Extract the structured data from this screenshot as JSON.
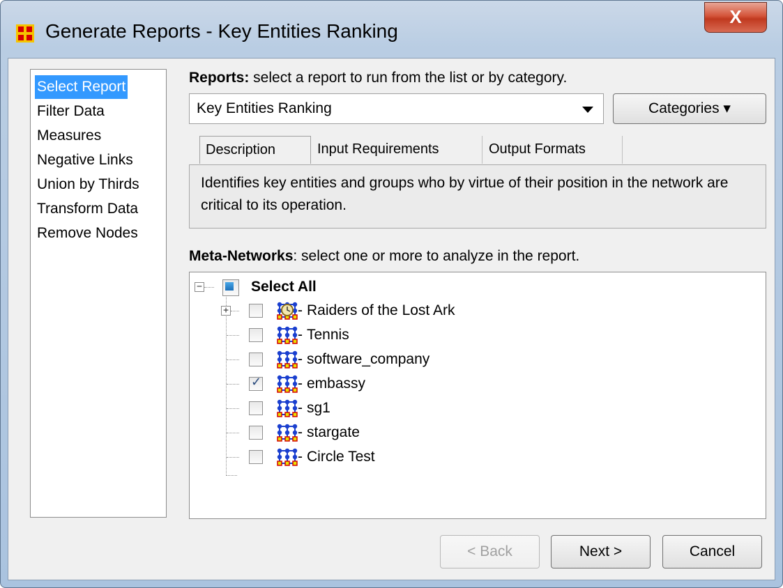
{
  "window": {
    "title": "Generate Reports - Key Entities Ranking",
    "close_label": "X"
  },
  "nav": {
    "items": [
      {
        "label": "Select Report",
        "selected": true
      },
      {
        "label": "Filter Data"
      },
      {
        "label": "Measures"
      },
      {
        "label": "Negative Links"
      },
      {
        "label": "Union by Thirds"
      },
      {
        "label": "Transform Data"
      },
      {
        "label": "Remove Nodes"
      }
    ]
  },
  "reports": {
    "heading_bold": "Reports:",
    "heading_rest": " select a report to run from the list or by category.",
    "selected": "Key Entities Ranking",
    "categories_label": "Categories ▾"
  },
  "tabs": [
    {
      "label": "Description",
      "active": true
    },
    {
      "label": "Input Requirements"
    },
    {
      "label": "Output Formats"
    }
  ],
  "description": "Identifies key entities and groups who by virtue of their position in the network are critical to its operation.",
  "meta": {
    "heading_bold": "Meta-Networks",
    "heading_rest": ": select one or more to analyze in the report.",
    "select_all": "Select All",
    "items": [
      {
        "label": "Raiders of the Lost Ark",
        "checked": false,
        "icon": "timed-network-icon",
        "expandable": true
      },
      {
        "label": "Tennis",
        "checked": false,
        "icon": "network-icon"
      },
      {
        "label": "software_company",
        "checked": false,
        "icon": "network-icon"
      },
      {
        "label": "embassy",
        "checked": true,
        "icon": "network-icon"
      },
      {
        "label": "sg1",
        "checked": false,
        "icon": "network-icon"
      },
      {
        "label": "stargate",
        "checked": false,
        "icon": "network-icon"
      },
      {
        "label": "Circle Test",
        "checked": false,
        "icon": "network-icon"
      }
    ]
  },
  "buttons": {
    "back": "< Back",
    "next": "Next >",
    "cancel": "Cancel"
  },
  "colors": {
    "selection": "#3399ff",
    "close": "#c84a32"
  }
}
